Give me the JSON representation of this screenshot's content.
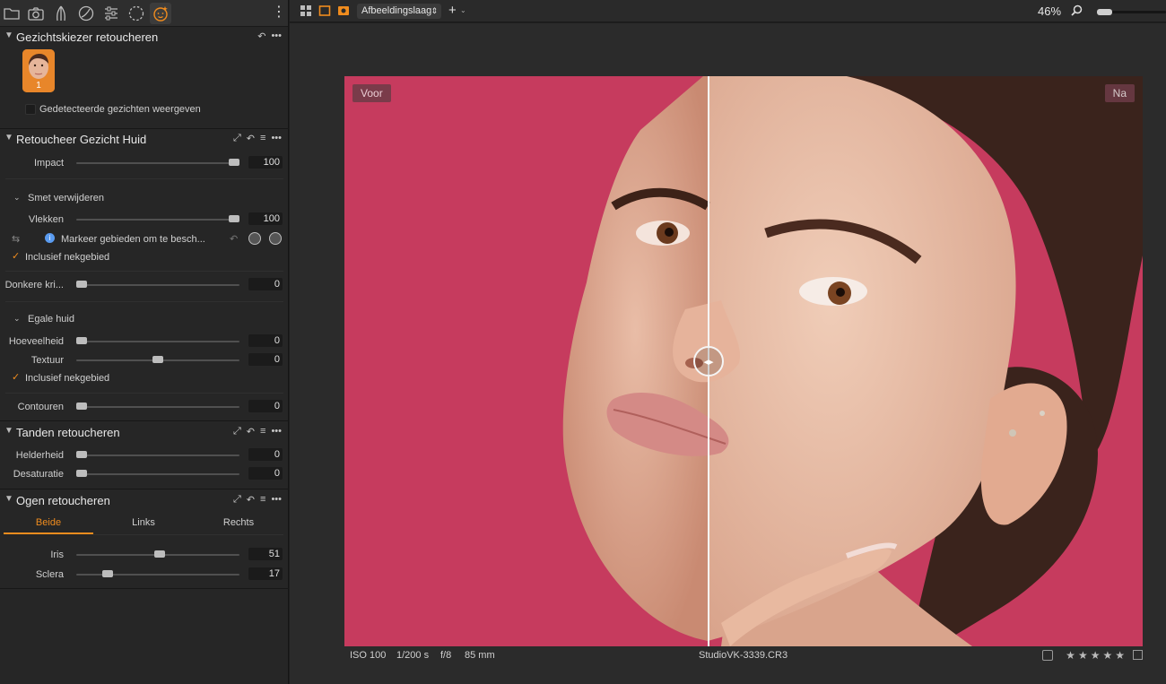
{
  "tooltabs": [
    "folder-icon",
    "camera-icon",
    "lens-icon",
    "exposure-icon",
    "adjustments-icon",
    "circle-dashed-icon",
    "face-retouch-icon"
  ],
  "face_selector": {
    "title": "Gezichtskiezer retoucheren",
    "face_number": "1",
    "show_faces_label": "Gedetecteerde gezichten weergeven"
  },
  "skin": {
    "title": "Retoucheer Gezicht Huid",
    "impact_label": "Impact",
    "impact_value": "100",
    "impact": 1.0,
    "blemish_title": "Smet verwijderen",
    "spots_label": "Vlekken",
    "spots_value": "100",
    "spots": 1.0,
    "mark_hint": "Markeer gebieden om te besch...",
    "incl_neck_1": "Inclusief nekgebied",
    "dark_circles_label": "Donkere kri...",
    "dark_circles_value": "0",
    "dark_circles": 0,
    "even_skin_title": "Egale huid",
    "amount_label": "Hoeveelheid",
    "amount_value": "0",
    "amount": 0,
    "texture_label": "Textuur",
    "texture_value": "0",
    "texture": 0.5,
    "incl_neck_2": "Inclusief nekgebied",
    "contours_label": "Contouren",
    "contours_value": "0",
    "contours": 0
  },
  "teeth": {
    "title": "Tanden retoucheren",
    "brightness_label": "Helderheid",
    "brightness_value": "0",
    "brightness": 0,
    "desat_label": "Desaturatie",
    "desat_value": "0",
    "desat": 0
  },
  "eyes": {
    "title": "Ogen retoucheren",
    "tabs": [
      "Beide",
      "Links",
      "Rechts"
    ],
    "iris_label": "Iris",
    "iris_value": "51",
    "iris": 0.51,
    "sclera_label": "Sclera",
    "sclera_value": "17",
    "sclera": 0.17
  },
  "topbar": {
    "layer_select": "Afbeeldingslaag",
    "zoom": "46%"
  },
  "viewer": {
    "before_label": "Voor",
    "after_label": "Na"
  },
  "status": {
    "iso": "ISO 100",
    "shutter": "1/200 s",
    "aperture": "f/8",
    "focal": "85 mm",
    "filename": "StudioVK-3339.CR3",
    "stars": [
      "★",
      "★",
      "★",
      "★",
      "★"
    ]
  },
  "colors": {
    "accent": "#f08c1e",
    "backdrop": "#c63b5e",
    "panel": "#262626"
  }
}
